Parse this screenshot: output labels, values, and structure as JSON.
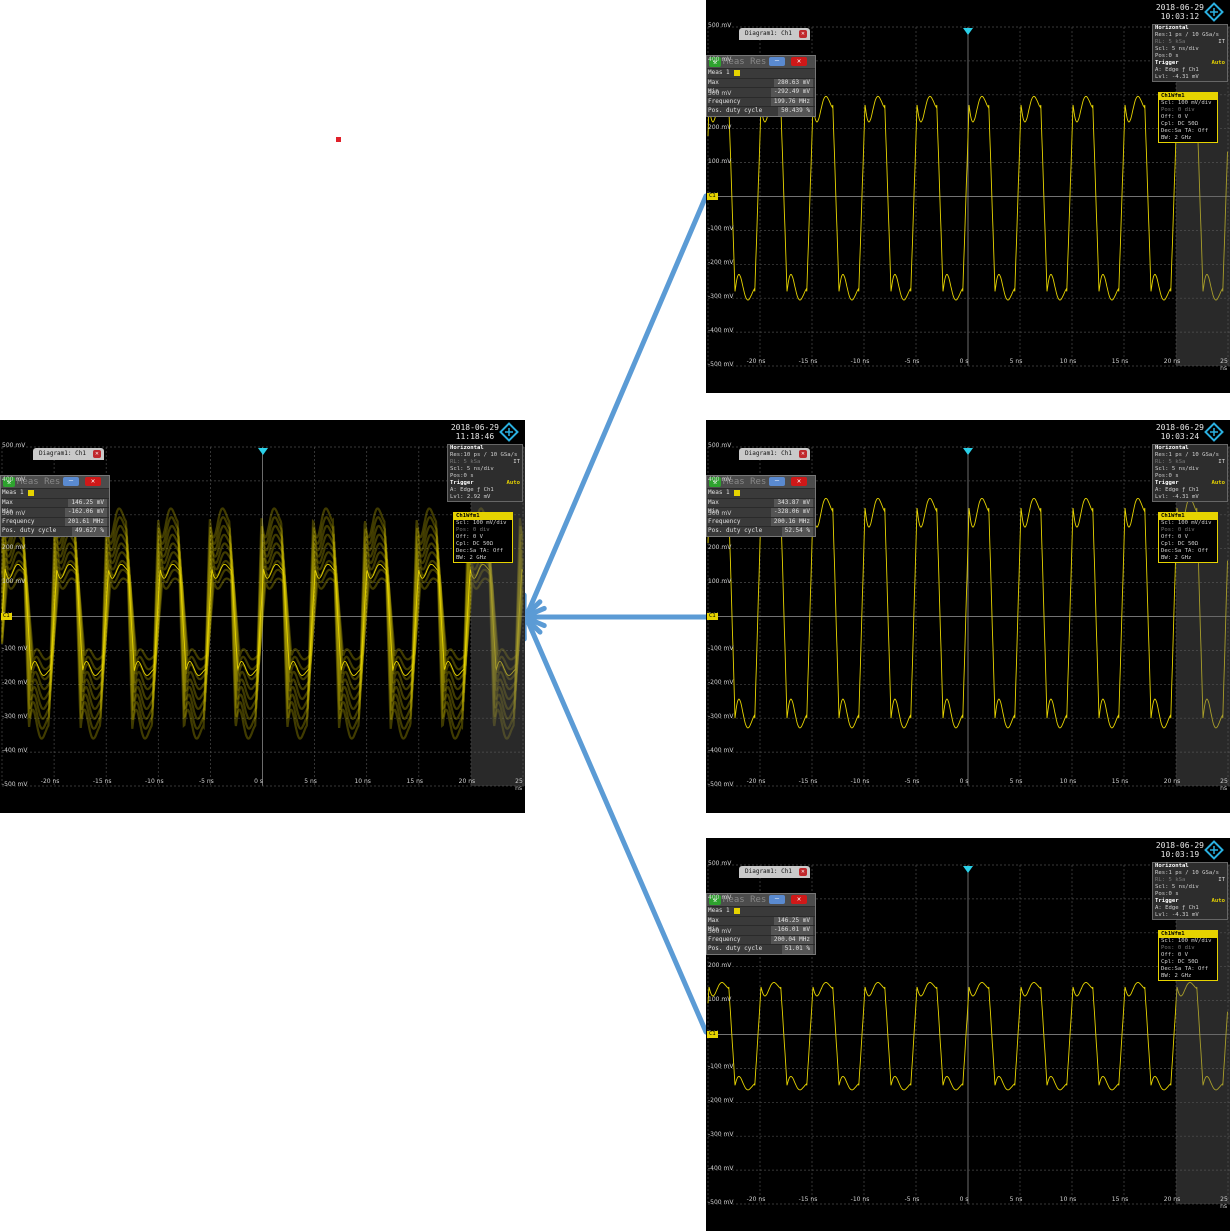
{
  "marker_color": "#e0202a",
  "arrow_color": "#5b9bd5",
  "trace_color": "#e6d300",
  "scopes": [
    {
      "id": "left",
      "date": "2018-06-29",
      "time": "11:18:46",
      "tab_label": "Diagram1: Ch1",
      "meas_title": "Meas Res",
      "meas_name": "Meas 1",
      "rows": [
        {
          "k": "Max",
          "v": "146.25 mV"
        },
        {
          "k": "Min",
          "v": "-162.06 mV"
        },
        {
          "k": "Frequency",
          "v": "201.61 MHz"
        },
        {
          "k": "Pos. duty cycle",
          "v": "49.627 %"
        }
      ],
      "horizontal": {
        "title": "Horizontal",
        "res": "Res:10 ps / 10 GSa/s",
        "rl": "RL: 5 kSa",
        "scl": "Scl: 5 ns/div",
        "pos": "Pos:0 s",
        "it": "IT"
      },
      "trigger": {
        "title": "Trigger",
        "auto": "Auto",
        "src": "A:  Edge  ƒ Ch1",
        "lvl": "Lvl: 2.92 mV"
      },
      "wfm": {
        "title": "Ch1Wfm1",
        "scl": "Scl: 100 mV/div",
        "pos": "Pos: 0 div",
        "off": "Off: 0 V",
        "cpl": "Cpl: DC 50Ω",
        "dec": "Dec:Sa    TA: Off",
        "bw": "BW: 2 GHz"
      },
      "waveform": {
        "hi_mV": 140,
        "lo_mV": -160,
        "period_ns": 4.96,
        "persist": true
      }
    },
    {
      "id": "top",
      "date": "2018-06-29",
      "time": "10:03:12",
      "tab_label": "Diagram1: Ch1",
      "meas_title": "Meas Res",
      "meas_name": "Meas 1",
      "rows": [
        {
          "k": "Max",
          "v": "280.63 mV"
        },
        {
          "k": "Min",
          "v": "-292.49 mV"
        },
        {
          "k": "Frequency",
          "v": "199.76 MHz"
        },
        {
          "k": "Pos. duty cycle",
          "v": "50.439 %"
        }
      ],
      "horizontal": {
        "title": "Horizontal",
        "res": "Res:1 ps / 10 GSa/s",
        "rl": "RL: 5 kSa",
        "scl": "Scl: 5 ns/div",
        "pos": "Pos:0 s",
        "it": "IT"
      },
      "trigger": {
        "title": "Trigger",
        "auto": "Auto",
        "src": "A:  Edge  ƒ Ch1",
        "lvl": "Lvl: -4.31 mV"
      },
      "wfm": {
        "title": "Ch1Wfm1",
        "scl": "Scl: 100 mV/div",
        "pos": "Pos: 0 div",
        "off": "Off: 0 V",
        "cpl": "Cpl: DC 50Ω",
        "dec": "Dec:Sa    TA: Off",
        "bw": "BW: 2 GHz"
      },
      "waveform": {
        "hi_mV": 270,
        "lo_mV": -280,
        "period_ns": 5.0,
        "persist": false
      }
    },
    {
      "id": "middle",
      "date": "2018-06-29",
      "time": "10:03:24",
      "tab_label": "Diagram1: Ch1",
      "meas_title": "Meas Res",
      "meas_name": "Meas 1",
      "rows": [
        {
          "k": "Max",
          "v": "343.87 mV"
        },
        {
          "k": "Min",
          "v": "-328.06 mV"
        },
        {
          "k": "Frequency",
          "v": "200.16 MHz"
        },
        {
          "k": "Pos. duty cycle",
          "v": "52.54 %"
        }
      ],
      "horizontal": {
        "title": "Horizontal",
        "res": "Res:1 ps / 10 GSa/s",
        "rl": "RL: 5 kSa",
        "scl": "Scl: 5 ns/div",
        "pos": "Pos:0 s",
        "it": "IT"
      },
      "trigger": {
        "title": "Trigger",
        "auto": "Auto",
        "src": "A:  Edge  ƒ Ch1",
        "lvl": "Lvl: -4.31 mV"
      },
      "wfm": {
        "title": "Ch1Wfm1",
        "scl": "Scl: 100 mV/div",
        "pos": "Pos: 0 div",
        "off": "Off: 0 V",
        "cpl": "Cpl: DC 50Ω",
        "dec": "Dec:Sa    TA: Off",
        "bw": "BW: 2 GHz"
      },
      "waveform": {
        "hi_mV": 320,
        "lo_mV": -300,
        "period_ns": 5.0,
        "persist": false
      }
    },
    {
      "id": "bottom",
      "date": "2018-06-29",
      "time": "10:03:19",
      "tab_label": "Diagram1: Ch1",
      "meas_title": "Meas Res",
      "meas_name": "Meas 1",
      "rows": [
        {
          "k": "Max",
          "v": "146.25 mV"
        },
        {
          "k": "Min",
          "v": "-166.01 mV"
        },
        {
          "k": "Frequency",
          "v": "200.04 MHz"
        },
        {
          "k": "Pos. duty cycle",
          "v": "51.01 %"
        }
      ],
      "horizontal": {
        "title": "Horizontal",
        "res": "Res:1 ps / 10 GSa/s",
        "rl": "RL: 5 kSa",
        "scl": "Scl: 5 ns/div",
        "pos": "Pos:0 s",
        "it": "IT"
      },
      "trigger": {
        "title": "Trigger",
        "auto": "Auto",
        "src": "A:  Edge  ƒ Ch1",
        "lvl": "Lvl: -4.31 mV"
      },
      "wfm": {
        "title": "Ch1Wfm1",
        "scl": "Scl: 100 mV/div",
        "pos": "Pos: 0 div",
        "off": "Off: 0 V",
        "cpl": "Cpl: DC 50Ω",
        "dec": "Dec:Sa    TA: Off",
        "bw": "BW: 2 GHz"
      },
      "waveform": {
        "hi_mV": 140,
        "lo_mV": -150,
        "period_ns": 5.0,
        "persist": false
      }
    }
  ],
  "y_ticks": [
    "500 mV",
    "400 mV",
    "300 mV",
    "200 mV",
    "100 mV",
    "0 V",
    "-100 mV",
    "-200 mV",
    "-300 mV",
    "-400 mV",
    "-500 mV"
  ],
  "x_ticks": [
    "-20 ns",
    "-15 ns",
    "-10 ns",
    "-5 ns",
    "0 s",
    "5 ns",
    "10 ns",
    "15 ns",
    "20 ns",
    "25 ns"
  ],
  "ch_marker": "C1"
}
